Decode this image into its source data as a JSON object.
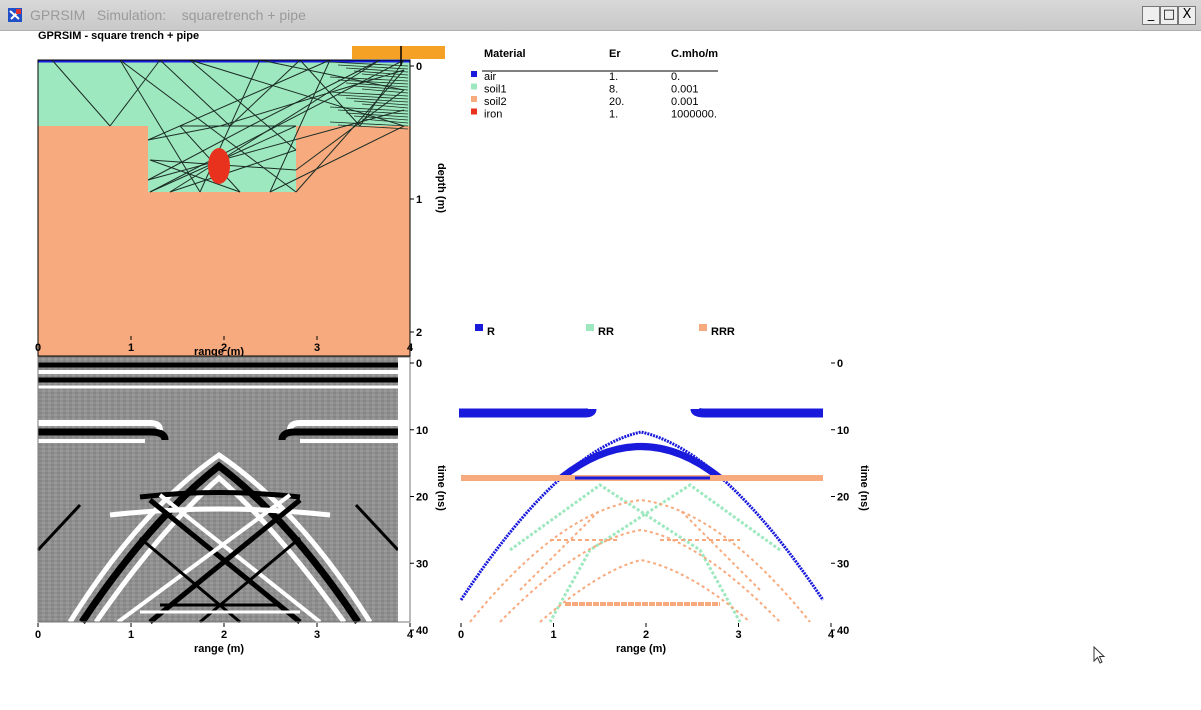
{
  "window": {
    "title": "GPRSIM   Simulation:    squaretrench + pipe",
    "minimize": "_",
    "maximize": "□",
    "close": "X"
  },
  "plot_title": "GPRSIM - square trench + pipe",
  "materials": {
    "headers": [
      "Material",
      "Er",
      "C.mho/m"
    ],
    "rows": [
      {
        "name": "air",
        "er": "1.",
        "c": "0.",
        "color": "#1a1adc"
      },
      {
        "name": "soil1",
        "er": "8.",
        "c": "0.001",
        "color": "#9ee8bf"
      },
      {
        "name": "soil2",
        "er": "20.",
        "c": "0.001",
        "color": "#f7aa7d"
      },
      {
        "name": "iron",
        "er": "1.",
        "c": "1000000.",
        "color": "#e8321e"
      }
    ]
  },
  "colors": {
    "air": "#1a1adc",
    "soil1": "#9ee8bf",
    "soil2": "#f7aa7d",
    "iron": "#e8321e",
    "antenna": "#f5a125"
  },
  "model_plot": {
    "xlabel": "range (m)",
    "ylabel": "depth (m)",
    "x_ticks": [
      "0",
      "1",
      "2",
      "3",
      "4"
    ],
    "y_ticks": [
      "0",
      "1",
      "2"
    ]
  },
  "radargram": {
    "xlabel": "range (m)",
    "ylabel": "time (ns)",
    "x_ticks": [
      "0",
      "1",
      "2",
      "3",
      "4"
    ],
    "y_ticks": [
      "0",
      "10",
      "20",
      "30",
      "40"
    ]
  },
  "ray_plot": {
    "xlabel": "range (m)",
    "ylabel": "time (ns)",
    "x_ticks": [
      "0",
      "1",
      "2",
      "3",
      "4"
    ],
    "y_ticks": [
      "0",
      "10",
      "20",
      "30",
      "40"
    ],
    "legend": [
      {
        "label": "R",
        "color": "#1a1adc"
      },
      {
        "label": "RR",
        "color": "#9ee8bf"
      },
      {
        "label": "RRR",
        "color": "#f7aa7d"
      }
    ]
  }
}
